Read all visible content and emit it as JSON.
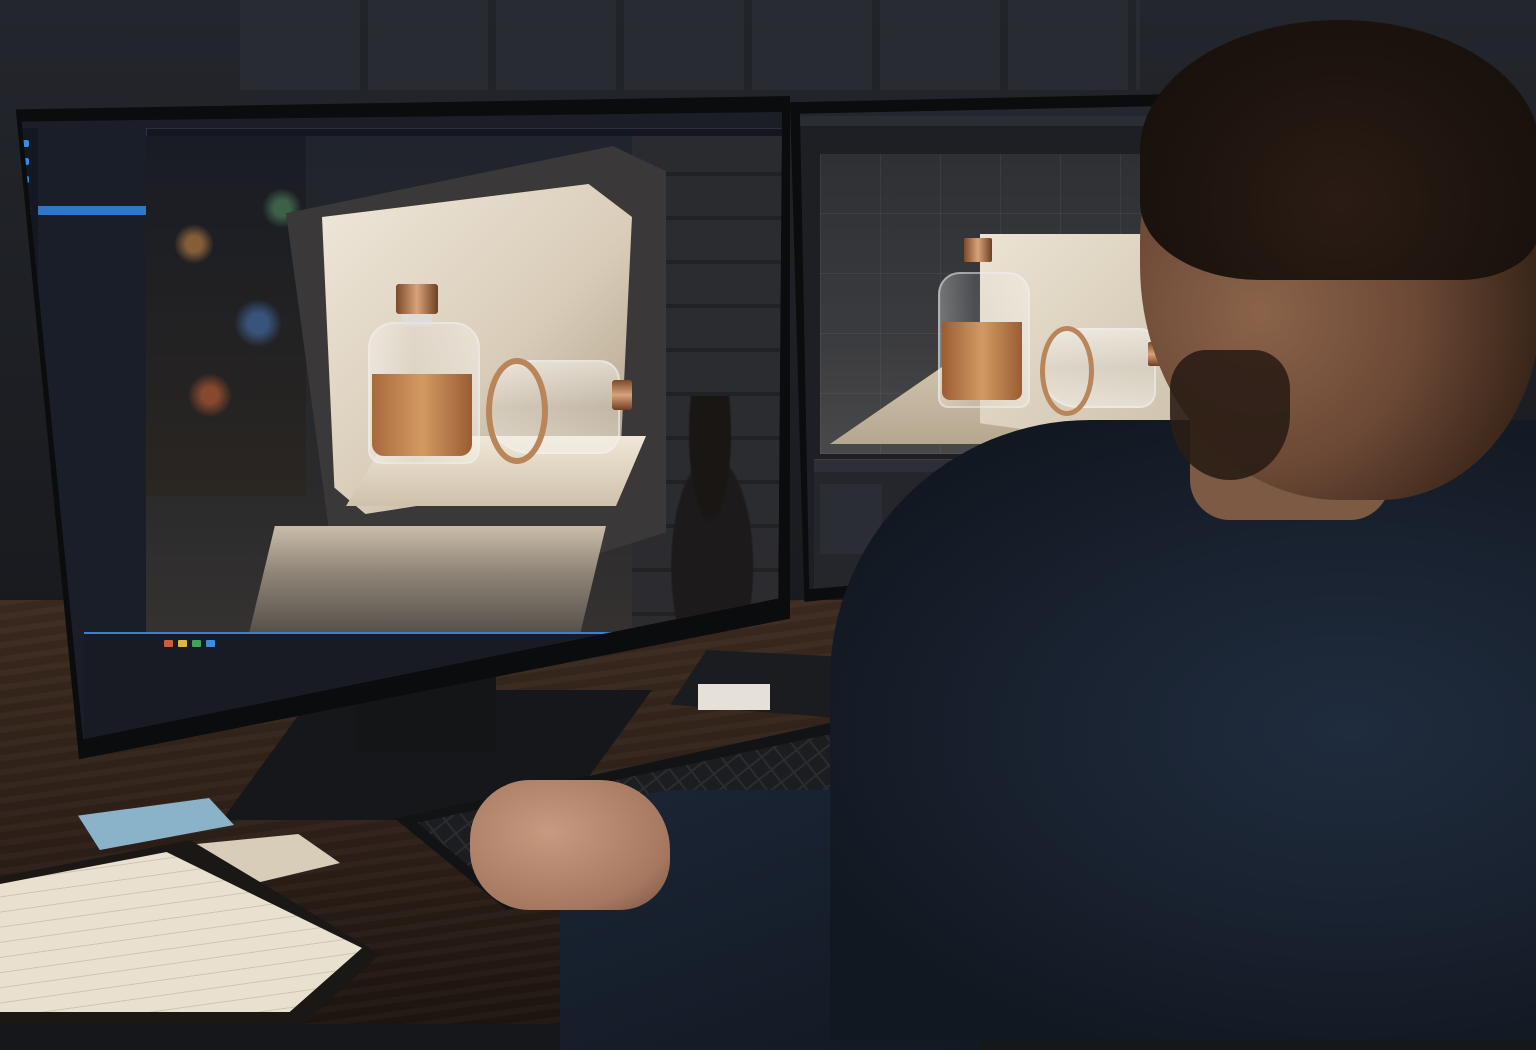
{
  "scene": {
    "description_colors": {
      "accent_blue": "#2f78c9",
      "bottle_amber": "#c98a55",
      "copper_cap": "#b9855a",
      "shirt_navy": "#18202d"
    }
  },
  "left_monitor": {
    "sidebar_items": [
      "",
      "",
      "",
      "",
      "",
      "",
      "",
      "",
      "",
      ""
    ],
    "timeline_rows": [
      "",
      "",
      "",
      "",
      "",
      ""
    ]
  },
  "right_monitor": {
    "outliner_rows": [
      "",
      "",
      "",
      "",
      "",
      ""
    ],
    "panel_rows": [
      "",
      "",
      "",
      "",
      "",
      ""
    ]
  }
}
